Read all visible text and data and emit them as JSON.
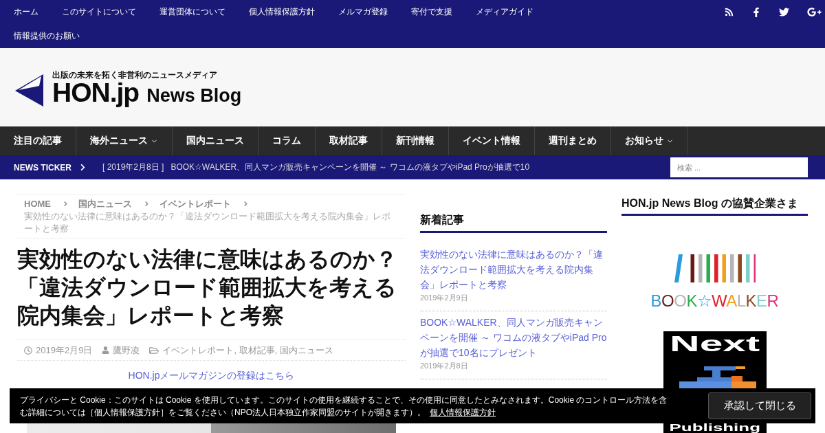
{
  "top_bar": {
    "links": [
      "ホーム",
      "このサイトについて",
      "運営団体について",
      "個人情報保護方針",
      "メルマガ登録",
      "寄付で支援",
      "メディアガイド",
      "情報提供のお願い"
    ]
  },
  "header": {
    "tagline": "出版の未来を拓く非営利のニュースメディア",
    "logo_name": "HON.jp",
    "logo_suffix": "News Blog"
  },
  "nav": {
    "items": [
      {
        "label": "注目の記事",
        "has_dropdown": false
      },
      {
        "label": "海外ニュース",
        "has_dropdown": true
      },
      {
        "label": "国内ニュース",
        "has_dropdown": false
      },
      {
        "label": "コラム",
        "has_dropdown": false
      },
      {
        "label": "取材記事",
        "has_dropdown": false
      },
      {
        "label": "新刊情報",
        "has_dropdown": false
      },
      {
        "label": "イベント情報",
        "has_dropdown": false
      },
      {
        "label": "週刊まとめ",
        "has_dropdown": false
      },
      {
        "label": "お知らせ",
        "has_dropdown": true
      }
    ]
  },
  "ticker": {
    "label": "NEWS TICKER",
    "date": "[ 2019年2月8日 ]",
    "headline": "BOOK☆WALKER、同人マンガ販売キャンペーンを開催 ～ ワコムの液タブやiPad Proが抽選で10"
  },
  "search": {
    "placeholder": "検索 ..."
  },
  "breadcrumb": {
    "links": [
      "HOME",
      "国内ニュース",
      "イベントレポート"
    ],
    "current": "実効性のない法律に意味はあるのか？「違法ダウンロード範囲拡大を考える院内集会」レポートと考察"
  },
  "article": {
    "title": "実効性のない法律に意味はあるのか？「違法ダウンロード範囲拡大を考える院内集会」レポートと考察",
    "date": "2019年2月9日",
    "author": "鷹野凌",
    "categories": "イベントレポート, 取材記事, 国内ニュース",
    "newsletter_link": "HON.jpメールマガジンの登録はこちら",
    "has_photo": true
  },
  "recent_posts": {
    "heading": "新着記事",
    "items": [
      {
        "title": "実効性のない法律に意味はあるのか？「違法ダウンロード範囲拡大を考える院内集会」レポートと考察",
        "date": "2019年2月9日"
      },
      {
        "title": "BOOK☆WALKER、同人マンガ販売キャンペーンを開催 ～ ワコムの液タブやiPad Proが抽選で10名にプレゼント",
        "date": "2019年2月8日"
      }
    ]
  },
  "sponsors": {
    "heading": "HON.jp News Blog の協賛企業さま",
    "logos": [
      {
        "kind": "stripes",
        "lines": [
          "BOOK☆WALKER"
        ]
      },
      {
        "kind": "panel",
        "lines": [
          "Next",
          "Publishing"
        ]
      }
    ]
  },
  "cookie_notice": {
    "text": "プライバシーと Cookie：このサイトは Cookie を使用しています。このサイトの使用を継続することで、その使用に同意したとみなされます。Cookie のコントロール方法を含む詳細については［個人情報保護方針］をご覧ください（NPO法人日本独立作家同盟のサイトが開きます）。",
    "link": "個人情報保護方針",
    "button": "承認して閉じる"
  }
}
